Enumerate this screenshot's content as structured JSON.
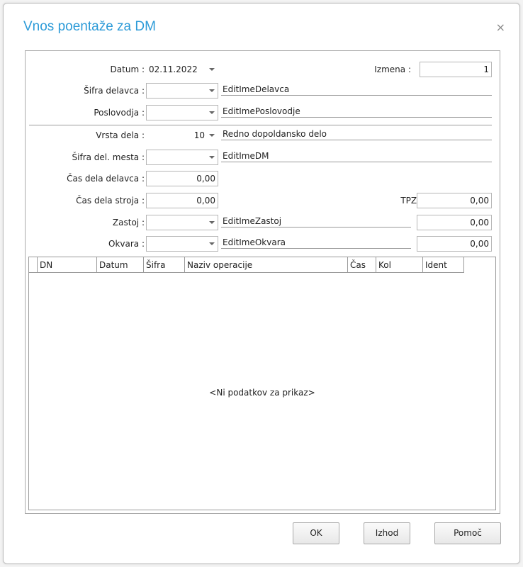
{
  "dialog": {
    "title": "Vnos poentaže za DM",
    "close": "×"
  },
  "form": {
    "datum": {
      "label": "Datum :",
      "value": "02.11.2022"
    },
    "izmena": {
      "label": "Izmena :",
      "value": "1"
    },
    "sifra_delavca": {
      "label": "Šifra delavca :",
      "value": "",
      "name": "EditImeDelavca"
    },
    "poslovodja": {
      "label": "Poslovodja :",
      "value": "",
      "name": "EditImePoslovodje"
    },
    "vrsta_dela": {
      "label": "Vrsta dela :",
      "value": "10",
      "name": "Redno dopoldansko delo"
    },
    "sifra_del_mesta": {
      "label": "Šifra del. mesta :",
      "value": "",
      "name": "EditImeDM"
    },
    "cas_dela_delavca": {
      "label": "Čas dela delavca :",
      "value": "0,00"
    },
    "cas_dela_stroja": {
      "label": "Čas dela stroja :",
      "value": "0,00"
    },
    "tpz": {
      "label": "TPZ :",
      "value": "0,00"
    },
    "zastoj": {
      "label": "Zastoj :",
      "value": "",
      "name": "EditImeZastoj",
      "amount": "0,00"
    },
    "okvara": {
      "label": "Okvara :",
      "value": "",
      "name": "EditImeOkvara",
      "amount": "0,00"
    }
  },
  "grid": {
    "columns": [
      "DN",
      "Datum",
      "Šifra",
      "Naziv operacije",
      "Čas",
      "Kol",
      "Ident"
    ],
    "empty_message": "<Ni podatkov za prikaz>"
  },
  "buttons": {
    "ok": "OK",
    "izhod": "Izhod",
    "pomoc": "Pomoč"
  }
}
